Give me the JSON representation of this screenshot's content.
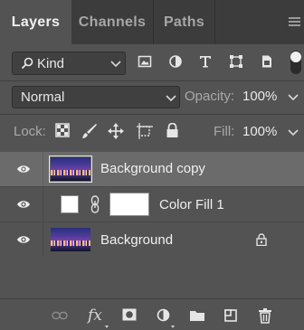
{
  "tabs": [
    {
      "label": "Layers",
      "active": true
    },
    {
      "label": "Channels",
      "active": false
    },
    {
      "label": "Paths",
      "active": false
    }
  ],
  "filter": {
    "kind_label": "Kind",
    "icons": [
      "image-filter-icon",
      "adjustment-filter-icon",
      "type-filter-icon",
      "shape-filter-icon",
      "smart-object-filter-icon"
    ],
    "toggle_on": true
  },
  "blend": {
    "mode": "Normal",
    "opacity_label": "Opacity:",
    "opacity_value": "100%"
  },
  "lock": {
    "label": "Lock:",
    "icons": [
      "lock-transparent-pixels-icon",
      "lock-image-pixels-icon",
      "lock-position-icon",
      "lock-artboard-icon",
      "lock-all-icon"
    ],
    "fill_label": "Fill:",
    "fill_value": "100%"
  },
  "layers": [
    {
      "name": "Background copy",
      "visible": true,
      "selected": true,
      "type": "pixel"
    },
    {
      "name": "Color Fill 1",
      "visible": true,
      "selected": false,
      "type": "fill",
      "fill_color": "#ffffff"
    },
    {
      "name": "Background",
      "visible": true,
      "selected": false,
      "type": "pixel",
      "locked": true
    }
  ],
  "bottom_bar": {
    "fx_label": "fx",
    "icons": [
      "link-layers-icon",
      "layer-style-icon",
      "add-mask-icon",
      "new-adjustment-icon",
      "new-group-icon",
      "new-layer-icon",
      "delete-layer-icon"
    ]
  },
  "colors": {
    "panel": "#535353",
    "tab_bar": "#3c3c3c",
    "selected_row": "#6b6b6b"
  }
}
